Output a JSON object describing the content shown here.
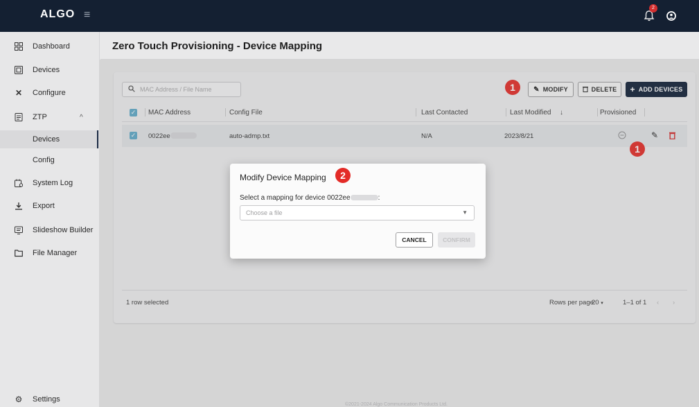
{
  "app": {
    "logo": "ALGO",
    "notification_count": "2"
  },
  "sidebar": {
    "items": [
      {
        "label": "Dashboard",
        "icon": "dashboard-icon"
      },
      {
        "label": "Devices",
        "icon": "devices-icon"
      },
      {
        "label": "Configure",
        "icon": "tools-icon"
      },
      {
        "label": "ZTP",
        "icon": "ztp-icon"
      },
      {
        "label": "Devices",
        "icon": ""
      },
      {
        "label": "Config",
        "icon": ""
      },
      {
        "label": "System Log",
        "icon": "system-log-icon"
      },
      {
        "label": "Export",
        "icon": "export-icon"
      },
      {
        "label": "Slideshow Builder",
        "icon": "slideshow-icon"
      },
      {
        "label": "File Manager",
        "icon": "folder-icon"
      }
    ],
    "settings_label": "Settings"
  },
  "page": {
    "title": "Zero Touch Provisioning - Device Mapping"
  },
  "toolbar": {
    "search_placeholder": "MAC Address / File Name",
    "modify_label": "MODIFY",
    "delete_label": "DELETE",
    "add_label": "ADD DEVICES",
    "callout_1": "1"
  },
  "table": {
    "columns": [
      "MAC Address",
      "Config File",
      "Last Contacted",
      "Last Modified",
      "Provisioned"
    ],
    "rows": [
      {
        "mac": "0022ee",
        "config": "auto-admp.txt",
        "last_contacted": "N/A",
        "last_modified": "2023/8/21"
      }
    ],
    "row_callout": "1"
  },
  "footer": {
    "selected": "1 row selected",
    "rows_per_page_label": "Rows per page:",
    "rows_per_page": "20",
    "range": "1–1 of 1"
  },
  "modal": {
    "title": "Modify Device Mapping",
    "callout": "2",
    "label_prefix": "Select a mapping for device 0022ee",
    "label_suffix": ":",
    "select_placeholder": "Choose a file",
    "cancel_label": "CANCEL",
    "confirm_label": "CONFIRM"
  },
  "copyright": "©2021-2024 Algo Communication Products Ltd.",
  "colors": {
    "topbar": "#142032",
    "primary": "#0f1f36",
    "callout": "#e32b27",
    "delete": "#d32f2f"
  }
}
